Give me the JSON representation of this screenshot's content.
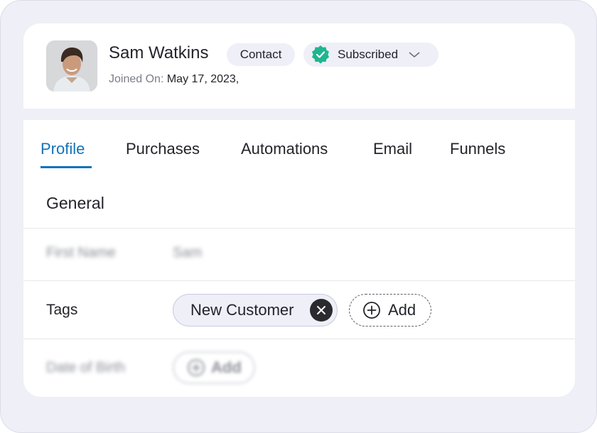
{
  "profile": {
    "name": "Sam Watkins",
    "role_badge": "Contact",
    "status": "Subscribed",
    "joined_label": "Joined On:",
    "joined_value": "May 17, 2023,"
  },
  "tabs": [
    {
      "label": "Profile",
      "active": true
    },
    {
      "label": "Purchases",
      "active": false
    },
    {
      "label": "Automations",
      "active": false
    },
    {
      "label": "Email",
      "active": false
    },
    {
      "label": "Funnels",
      "active": false
    }
  ],
  "general": {
    "title": "General",
    "first_name_label": "First Name",
    "first_name_value": "Sam",
    "tags_label": "Tags",
    "tags": [
      "New Customer"
    ],
    "add_label": "Add",
    "dob_label": "Date of Birth",
    "dob_add_label": "Add"
  },
  "colors": {
    "accent": "#1373b8",
    "status_badge": "#1fb58f",
    "background": "#eeeff7"
  },
  "icons": {
    "status": "verified-badge-icon",
    "dropdown": "chevron-down-icon",
    "remove_tag": "close-circle-icon",
    "add": "plus-circle-icon"
  }
}
